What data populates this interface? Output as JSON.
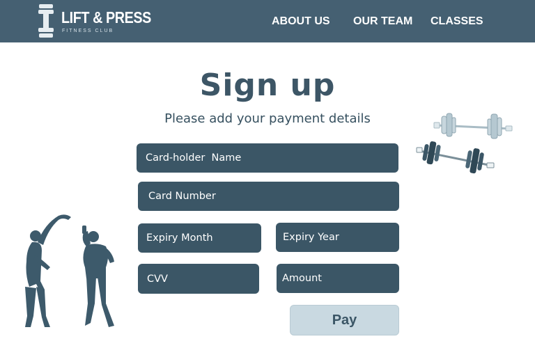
{
  "header": {
    "brand": {
      "name": "LIFT & PRESS",
      "tagline": "FITNESS CLUB"
    },
    "nav": [
      {
        "label": "ABOUT US"
      },
      {
        "label": "OUR TEAM"
      },
      {
        "label": "CLASSES"
      }
    ]
  },
  "main": {
    "title": "Sign up",
    "subtitle": "Please add your payment details",
    "form": {
      "cardholder_name": {
        "placeholder": "Card-holder  Name",
        "value": ""
      },
      "card_number": {
        "placeholder": "Card Number",
        "value": ""
      },
      "expiry_month": {
        "placeholder": "Expiry Month",
        "value": ""
      },
      "expiry_year": {
        "placeholder": "Expiry Year",
        "value": ""
      },
      "cvv": {
        "placeholder": "CVV",
        "value": ""
      },
      "amount": {
        "placeholder": "Amount",
        "value": ""
      },
      "submit_label": "Pay"
    }
  },
  "decor": {
    "icons": [
      "dumbbell-logo-icon",
      "barbells-illustration",
      "stretching-people-illustration"
    ]
  },
  "colors": {
    "header_bg": "#456072",
    "field_bg": "#3b5666",
    "button_bg": "#c9d9e1",
    "title_text": "#3d5666"
  }
}
